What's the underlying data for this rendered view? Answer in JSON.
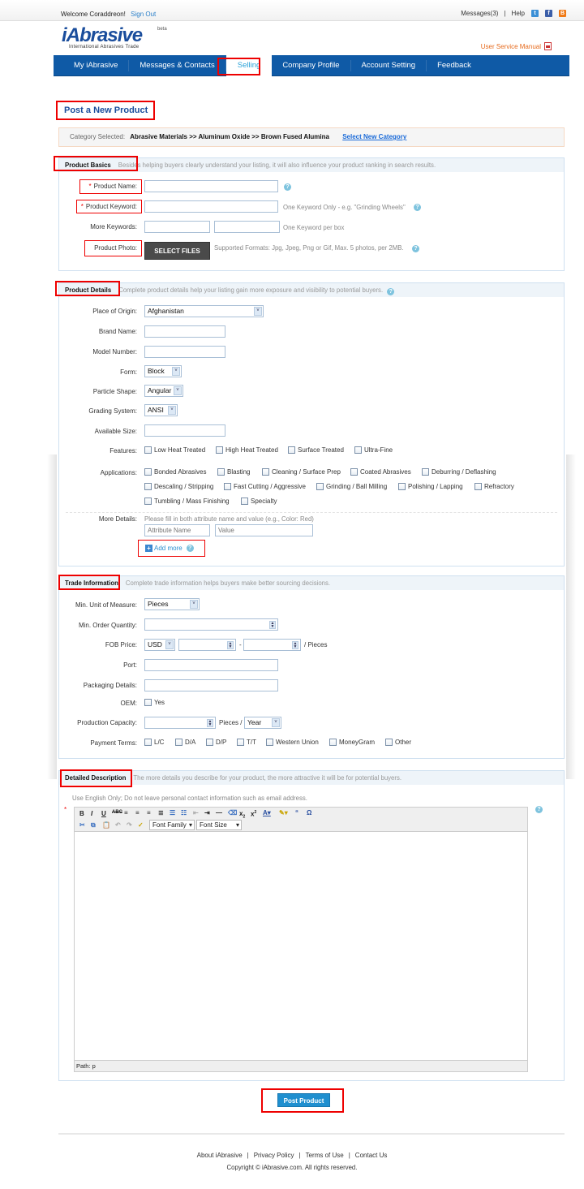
{
  "topbar": {
    "welcome": "Welcome Coraddreon!",
    "sign_out": "Sign Out",
    "messages": "Messages(3)",
    "separator": "|",
    "help": "Help",
    "social_icons": [
      "twitter-icon",
      "facebook-icon",
      "blogger-icon"
    ]
  },
  "logo": {
    "brand": "iAbrasive",
    "beta": "beta",
    "tagline": "International Abrasives Trade"
  },
  "user_manual": "User Service Manual",
  "nav": {
    "items": [
      {
        "label": "My iAbrasive",
        "active": false
      },
      {
        "label": "Messages & Contacts",
        "active": false
      },
      {
        "label": "Selling",
        "active": true
      },
      {
        "label": "Company Profile",
        "active": false
      },
      {
        "label": "Account Setting",
        "active": false
      },
      {
        "label": "Feedback",
        "active": false
      }
    ]
  },
  "page_title": "Post a New Product",
  "category": {
    "label": "Category Selected:",
    "path": "Abrasive Materials >> Aluminum Oxide >> Brown Fused Alumina",
    "change_link": "Select New Category"
  },
  "basics": {
    "title": "Product Basics",
    "desc": "Besides helping buyers clearly understand your listing, it will also influence your product ranking in search results.",
    "product_name_label": "Product Name:",
    "product_name_value": "",
    "keyword_label": "Product Keyword:",
    "keyword_value": "",
    "keyword_hint": "One Keyword Only - e.g. \"Grinding Wheels\"",
    "more_keywords_label": "More Keywords:",
    "more_keywords_hint": "One Keyword per box",
    "photo_label": "Product Photo:",
    "select_files": "SELECT FILES",
    "photo_hint": "Supported Formats: Jpg, Jpeg, Png or Gif, Max. 5 photos, per 2MB.",
    "required_mark": "*"
  },
  "details": {
    "title": "Product Details",
    "desc": "Complete product details help your listing gain more exposure and visibility to potential buyers.",
    "origin_label": "Place of Origin:",
    "origin_value": "Afghanistan",
    "brand_label": "Brand Name:",
    "model_label": "Model Number:",
    "form_label": "Form:",
    "form_value": "Block",
    "shape_label": "Particle Shape:",
    "shape_value": "Angular",
    "grading_label": "Grading System:",
    "grading_value": "ANSI",
    "size_label": "Available Size:",
    "features_label": "Features:",
    "features": [
      "Low Heat Treated",
      "High Heat Treated",
      "Surface Treated",
      "Ultra-Fine"
    ],
    "applications_label": "Applications:",
    "applications": [
      "Bonded Abrasives",
      "Blasting",
      "Cleaning / Surface Prep",
      "Coated Abrasives",
      "Deburring / Deflashing",
      "Descaling / Stripping",
      "Fast Cutting / Aggressive",
      "Grinding / Ball Milling",
      "Polishing / Lapping",
      "Refractory",
      "Tumbling / Mass Finishing",
      "Specialty"
    ],
    "more_label": "More Details:",
    "more_hint": "Please fill in both attribute name and value (e.g., Color: Red)",
    "attr_placeholder": "Attribute Name",
    "value_placeholder": "Value",
    "add_more": "Add more"
  },
  "trade": {
    "title": "Trade Information",
    "desc": "Complete trade information helps buyers make better sourcing decisions.",
    "unit_label": "Min. Unit of Measure:",
    "unit_value": "Pieces",
    "moq_label": "Min. Order Quantity:",
    "fob_label": "FOB Price:",
    "currency": "USD",
    "dash": "-",
    "per_unit": "/ Pieces",
    "port_label": "Port:",
    "packaging_label": "Packaging Details:",
    "oem_label": "OEM:",
    "oem_option": "Yes",
    "capacity_label": "Production Capacity:",
    "capacity_unit": "Pieces /",
    "capacity_period": "Year",
    "payment_label": "Payment Terms:",
    "payment_options": [
      "L/C",
      "D/A",
      "D/P",
      "T/T",
      "Western Union",
      "MoneyGram",
      "Other"
    ]
  },
  "description": {
    "title": "Detailed Description",
    "desc": "The more details you describe for your product, the more attractive it will be for potential buyers.",
    "note": "Use English Only; Do not leave personal contact information such as email address.",
    "required_mark": "*",
    "font_family": "Font Family",
    "font_size": "Font Size",
    "path": "Path: p",
    "toolbar_row1": [
      "bold",
      "italic",
      "underline",
      "strikethrough",
      "align-left",
      "align-center",
      "align-right",
      "justify",
      "bullet-list",
      "numbered-list",
      "outdent",
      "indent",
      "horizontal-rule",
      "remove-format",
      "subscript",
      "superscript",
      "text-color",
      "highlight-color",
      "blockquote",
      "special-char"
    ],
    "toolbar_row2": [
      "cut",
      "copy",
      "paste",
      "undo",
      "redo",
      "cleanup"
    ]
  },
  "submit": "Post Product",
  "footer": {
    "links": [
      "About iAbrasive",
      "Privacy Policy",
      "Terms of Use",
      "Contact Us"
    ],
    "copyright": "Copyright © iAbrasive.com. All rights reserved."
  },
  "colors": {
    "nav_bg": "#0f5aa6",
    "accent": "#2ba3d8",
    "title": "#1a4d9c",
    "annotation": "#ee0000",
    "manual_link": "#e66a1c"
  }
}
